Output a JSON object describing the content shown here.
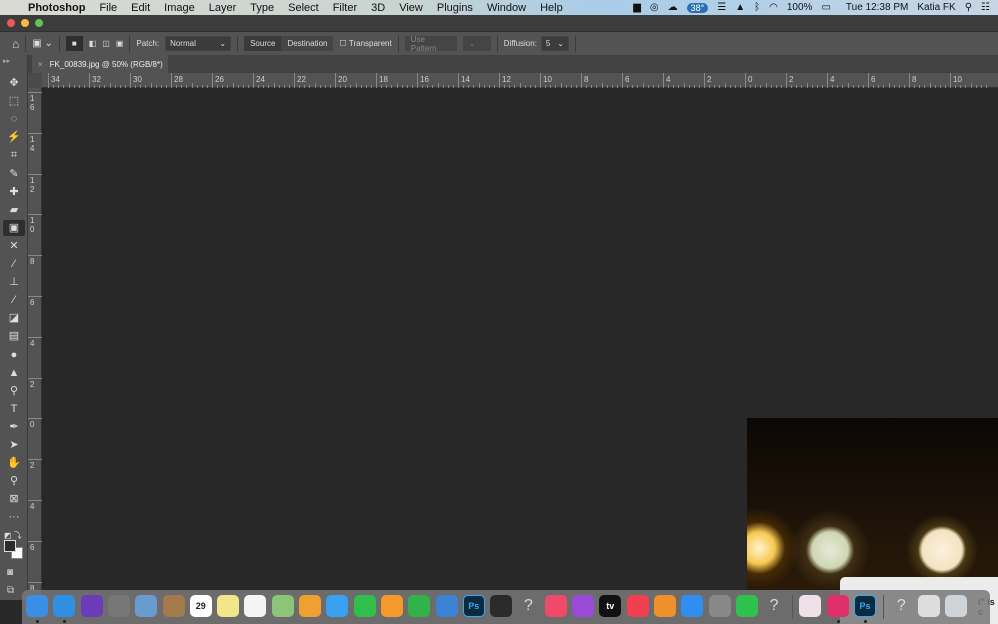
{
  "menubar": {
    "app": "Photoshop",
    "items": [
      "File",
      "Edit",
      "Image",
      "Layer",
      "Type",
      "Select",
      "Filter",
      "3D",
      "View",
      "Plugins",
      "Window",
      "Help"
    ],
    "status": {
      "temperature": "38°",
      "battery": "100%",
      "clock": "Tue 12:38 PM",
      "user": "Katia FK"
    }
  },
  "options": {
    "patch_label": "Patch:",
    "patch_value": "Normal",
    "source": "Source",
    "destination": "Destination",
    "transparent": "Transparent",
    "use_pattern": "Use Pattern",
    "diffusion_label": "Diffusion:",
    "diffusion_value": "5"
  },
  "document": {
    "tab_title": "FK_00839.jpg @ 50% (RGB/8*)",
    "close": "×"
  },
  "rulers": {
    "horizontal": [
      "34",
      "32",
      "30",
      "28",
      "26",
      "24",
      "22",
      "20",
      "18",
      "16",
      "14",
      "12",
      "10",
      "8",
      "6",
      "4",
      "2",
      "0",
      "2",
      "4",
      "6",
      "8",
      "10"
    ],
    "vertical": [
      "16",
      "14",
      "12",
      "10",
      "8",
      "6",
      "4",
      "2",
      "0",
      "2",
      "4",
      "6",
      "8"
    ]
  },
  "tools": [
    {
      "name": "move-tool",
      "glyph": "✥"
    },
    {
      "name": "marquee-tool",
      "glyph": "⬚"
    },
    {
      "name": "lasso-tool",
      "glyph": "◌"
    },
    {
      "name": "magic-wand-tool",
      "glyph": "⚡"
    },
    {
      "name": "crop-tool",
      "glyph": "⌗"
    },
    {
      "name": "eyedropper-tool",
      "glyph": "✎"
    },
    {
      "name": "spot-healing-tool",
      "glyph": "✚"
    },
    {
      "name": "healing-brush-tool",
      "glyph": "▰"
    },
    {
      "name": "patch-tool",
      "glyph": "▣",
      "active": true
    },
    {
      "name": "content-aware-move-tool",
      "glyph": "✕"
    },
    {
      "name": "brush-tool",
      "glyph": "∕"
    },
    {
      "name": "clone-stamp-tool",
      "glyph": "⊥"
    },
    {
      "name": "history-brush-tool",
      "glyph": "⁄"
    },
    {
      "name": "eraser-tool",
      "glyph": "◪"
    },
    {
      "name": "gradient-tool",
      "glyph": "▤"
    },
    {
      "name": "blur-tool",
      "glyph": "●"
    },
    {
      "name": "sharpen-tool",
      "glyph": "▲"
    },
    {
      "name": "dodge-tool",
      "glyph": "⚲"
    },
    {
      "name": "type-tool",
      "glyph": "T"
    },
    {
      "name": "pen-tool",
      "glyph": "✒"
    },
    {
      "name": "path-selection-tool",
      "glyph": "➤"
    },
    {
      "name": "hand-tool",
      "glyph": "✋"
    },
    {
      "name": "zoom-tool",
      "glyph": "⚲"
    },
    {
      "name": "frame-tool",
      "glyph": "⊠"
    },
    {
      "name": "more-tools",
      "glyph": "···"
    }
  ],
  "dock": [
    {
      "name": "finder",
      "color": "#3a8ee6",
      "running": true
    },
    {
      "name": "safari",
      "color": "#2f8fe0",
      "running": true
    },
    {
      "name": "siri",
      "color": "#6b3bb8"
    },
    {
      "name": "launchpad",
      "color": "#777"
    },
    {
      "name": "preview",
      "color": "#6a9bd0"
    },
    {
      "name": "contacts",
      "color": "#a47a4a"
    },
    {
      "name": "calendar",
      "color": "#fff",
      "label": "29"
    },
    {
      "name": "notes",
      "color": "#f3e58a"
    },
    {
      "name": "reminders",
      "color": "#f4f4f4"
    },
    {
      "name": "maps",
      "color": "#8cc47a"
    },
    {
      "name": "photos",
      "color": "#f0a030"
    },
    {
      "name": "messages",
      "color": "#3aa0f0"
    },
    {
      "name": "facetime",
      "color": "#2fbf4a"
    },
    {
      "name": "pages",
      "color": "#f39a2a"
    },
    {
      "name": "numbers",
      "color": "#32b34a"
    },
    {
      "name": "keynote",
      "color": "#3c83d6"
    },
    {
      "name": "photoshop",
      "color": "#0b2a3c",
      "label": "Ps"
    },
    {
      "name": "quicktime",
      "color": "#2a2a2a"
    },
    {
      "name": "unknown-app",
      "color": "transparent",
      "label": "?"
    },
    {
      "name": "music",
      "color": "#f04a6a"
    },
    {
      "name": "podcasts",
      "color": "#9a4ad6"
    },
    {
      "name": "tv",
      "color": "#111",
      "label": "tv"
    },
    {
      "name": "news",
      "color": "#f04050"
    },
    {
      "name": "books",
      "color": "#f0902a"
    },
    {
      "name": "app-store",
      "color": "#2f8ff0"
    },
    {
      "name": "system-preferences",
      "color": "#888"
    },
    {
      "name": "whatsapp",
      "color": "#2fc150"
    },
    {
      "name": "unknown-app-2",
      "color": "transparent",
      "label": "?"
    },
    {
      "name": "cleanmymac",
      "color": "#f0e0e8",
      "sep": true
    },
    {
      "name": "creative-cloud",
      "color": "#e0306a",
      "running": true
    },
    {
      "name": "photoshop-2",
      "color": "#0b2a3c",
      "label": "Ps",
      "running": true
    },
    {
      "name": "unknown-app-3",
      "color": "transparent",
      "label": "?",
      "sep": true
    },
    {
      "name": "document-file",
      "color": "#ddd"
    },
    {
      "name": "trash",
      "color": "#cfd4d8"
    }
  ],
  "dialog": {
    "text": "i\" is c"
  }
}
